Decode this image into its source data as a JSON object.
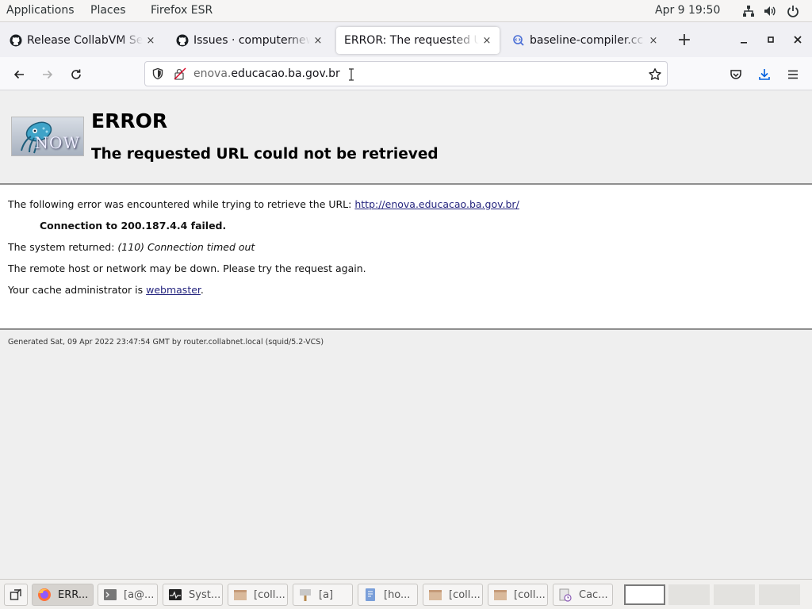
{
  "topbar": {
    "applications": "Applications",
    "places": "Places",
    "app_name": "Firefox ESR",
    "clock": "Apr 9  19:50"
  },
  "tabs": [
    {
      "label": "Release CollabVM Server",
      "icon": "github-icon",
      "close": "×"
    },
    {
      "label": "Issues · computernewb/collab-vm",
      "icon": "github-icon",
      "close": "×"
    },
    {
      "label": "ERROR: The requested URL could not be retrieved",
      "icon": "none",
      "close": "×"
    },
    {
      "label": "baseline-compiler.cc - Code Search",
      "icon": "code-search-icon",
      "close": "×"
    }
  ],
  "newtab": "+",
  "window_controls": {
    "minimize": "–",
    "maximize": "▫",
    "close": "✕"
  },
  "url": {
    "prefix": "enova.",
    "domain": "educacao.ba.gov.br"
  },
  "error_page": {
    "logo_text": "NOW",
    "title": "ERROR",
    "subtitle": "The requested URL could not be retrieved",
    "line1_text": "The following error was encountered while trying to retrieve the URL: ",
    "line1_link": "http://enova.educacao.ba.gov.br/",
    "connection": "Connection to 200.187.4.4 failed.",
    "returned_prefix": "The system returned: ",
    "returned_error": "(110) Connection timed out",
    "remote": "The remote host or network may be down. Please try the request again.",
    "admin_prefix": "Your cache administrator is ",
    "admin_link": "webmaster",
    "admin_suffix": ".",
    "footer": "Generated Sat, 09 Apr 2022 23:47:54 GMT by router.collabnet.local (squid/5.2-VCS)"
  },
  "taskbar": {
    "items": [
      {
        "label": "ERR...",
        "icon": "firefox-icon",
        "active": true
      },
      {
        "label": "[a@...",
        "icon": "terminal-icon",
        "active": false
      },
      {
        "label": "Syst...",
        "icon": "system-monitor-icon",
        "active": false
      },
      {
        "label": "[coll...",
        "icon": "package-icon",
        "active": false
      },
      {
        "label": "[a]",
        "icon": "text-editor-icon",
        "active": false
      },
      {
        "label": "[ho...",
        "icon": "document-icon",
        "active": false
      },
      {
        "label": "[coll...",
        "icon": "package-icon",
        "active": false
      },
      {
        "label": "[coll...",
        "icon": "package-icon",
        "active": false
      },
      {
        "label": "Cac...",
        "icon": "archive-icon",
        "active": false
      }
    ]
  },
  "colors": {
    "link": "#26267f",
    "accent_download": "#0060df"
  }
}
